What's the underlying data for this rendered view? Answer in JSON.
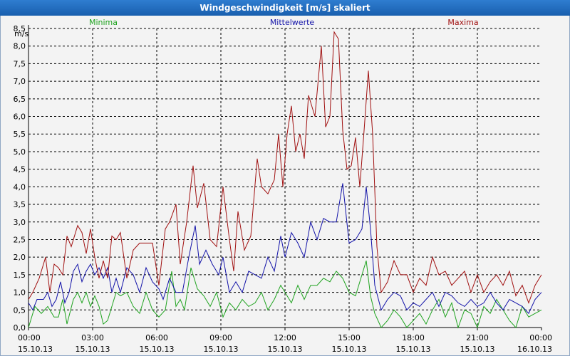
{
  "window": {
    "title": "Windgeschwindigkeit [m/s] skaliert"
  },
  "colors": {
    "minima": "#1fa31f",
    "mittel": "#1212a8",
    "maxima": "#a01010",
    "grid": "#000000"
  },
  "chart_data": {
    "type": "line",
    "title": "Windgeschwindigkeit [m/s] skaliert",
    "ylabel": "m/s",
    "ylim": [
      0,
      8.5
    ],
    "yticks": [
      "0,0",
      "0,5",
      "1,0",
      "1,5",
      "2,0",
      "2,5",
      "3,0",
      "3,5",
      "4,0",
      "4,5",
      "5,0",
      "5,5",
      "6,0",
      "6,5",
      "7,0",
      "7,5",
      "8,0",
      "8,5"
    ],
    "xlim": [
      0,
      24
    ],
    "xticks": [
      {
        "time": "00:00",
        "date": "15.10.13"
      },
      {
        "time": "03:00",
        "date": "15.10.13"
      },
      {
        "time": "06:00",
        "date": "15.10.13"
      },
      {
        "time": "09:00",
        "date": "15.10.13"
      },
      {
        "time": "12:00",
        "date": "15.10.13"
      },
      {
        "time": "15:00",
        "date": "15.10.13"
      },
      {
        "time": "18:00",
        "date": "15.10.13"
      },
      {
        "time": "21:00",
        "date": "15.10.13"
      },
      {
        "time": "00:00",
        "date": "16.10.13"
      }
    ],
    "grid": true,
    "legend_position": "top",
    "series": [
      {
        "name": "Minima",
        "color": "#1fa31f",
        "points": [
          [
            0,
            0.0
          ],
          [
            0.3,
            0.6
          ],
          [
            0.6,
            0.4
          ],
          [
            0.9,
            0.6
          ],
          [
            1.2,
            0.3
          ],
          [
            1.4,
            0.3
          ],
          [
            1.6,
            0.8
          ],
          [
            1.8,
            0.1
          ],
          [
            2.1,
            0.8
          ],
          [
            2.3,
            1.0
          ],
          [
            2.5,
            0.7
          ],
          [
            2.7,
            1.0
          ],
          [
            2.9,
            0.6
          ],
          [
            3.1,
            0.9
          ],
          [
            3.3,
            0.6
          ],
          [
            3.5,
            0.1
          ],
          [
            3.7,
            0.2
          ],
          [
            3.9,
            0.6
          ],
          [
            4.1,
            1.0
          ],
          [
            4.3,
            0.9
          ],
          [
            4.6,
            1.0
          ],
          [
            4.9,
            0.6
          ],
          [
            5.2,
            0.4
          ],
          [
            5.5,
            1.0
          ],
          [
            5.8,
            0.5
          ],
          [
            6.1,
            0.3
          ],
          [
            6.4,
            0.5
          ],
          [
            6.7,
            1.6
          ],
          [
            6.9,
            0.6
          ],
          [
            7.1,
            0.8
          ],
          [
            7.3,
            0.5
          ],
          [
            7.6,
            1.7
          ],
          [
            7.9,
            1.1
          ],
          [
            8.2,
            0.9
          ],
          [
            8.5,
            0.6
          ],
          [
            8.8,
            1.0
          ],
          [
            9.1,
            0.3
          ],
          [
            9.4,
            0.7
          ],
          [
            9.7,
            0.5
          ],
          [
            10.0,
            0.8
          ],
          [
            10.3,
            0.6
          ],
          [
            10.6,
            0.7
          ],
          [
            10.9,
            1.0
          ],
          [
            11.2,
            0.5
          ],
          [
            11.5,
            0.8
          ],
          [
            11.8,
            1.2
          ],
          [
            12.0,
            1.0
          ],
          [
            12.3,
            0.7
          ],
          [
            12.6,
            1.2
          ],
          [
            12.9,
            0.8
          ],
          [
            13.2,
            1.2
          ],
          [
            13.5,
            1.2
          ],
          [
            13.8,
            1.4
          ],
          [
            14.1,
            1.3
          ],
          [
            14.4,
            1.6
          ],
          [
            14.7,
            1.4
          ],
          [
            15.0,
            1.0
          ],
          [
            15.3,
            0.9
          ],
          [
            15.6,
            1.5
          ],
          [
            15.8,
            1.9
          ],
          [
            16.0,
            0.9
          ],
          [
            16.2,
            0.4
          ],
          [
            16.5,
            0.0
          ],
          [
            16.8,
            0.2
          ],
          [
            17.1,
            0.5
          ],
          [
            17.4,
            0.3
          ],
          [
            17.7,
            0.0
          ],
          [
            18.0,
            0.2
          ],
          [
            18.3,
            0.4
          ],
          [
            18.6,
            0.1
          ],
          [
            18.9,
            0.5
          ],
          [
            19.2,
            0.8
          ],
          [
            19.5,
            0.3
          ],
          [
            19.8,
            0.7
          ],
          [
            20.1,
            0.0
          ],
          [
            20.4,
            0.5
          ],
          [
            20.7,
            0.4
          ],
          [
            21.0,
            0.0
          ],
          [
            21.3,
            0.6
          ],
          [
            21.6,
            0.4
          ],
          [
            21.9,
            0.8
          ],
          [
            22.2,
            0.5
          ],
          [
            22.5,
            0.2
          ],
          [
            22.8,
            0.0
          ],
          [
            23.1,
            0.6
          ],
          [
            23.4,
            0.3
          ],
          [
            23.7,
            0.4
          ],
          [
            24.0,
            0.5
          ]
        ]
      },
      {
        "name": "Mittelwerte",
        "color": "#1212a8",
        "points": [
          [
            0,
            0.7
          ],
          [
            0.2,
            0.5
          ],
          [
            0.4,
            0.8
          ],
          [
            0.7,
            0.8
          ],
          [
            0.9,
            1.0
          ],
          [
            1.1,
            0.6
          ],
          [
            1.3,
            0.8
          ],
          [
            1.5,
            1.3
          ],
          [
            1.7,
            0.7
          ],
          [
            1.9,
            1.0
          ],
          [
            2.1,
            1.6
          ],
          [
            2.3,
            1.8
          ],
          [
            2.5,
            1.3
          ],
          [
            2.7,
            1.6
          ],
          [
            2.9,
            1.8
          ],
          [
            3.1,
            1.5
          ],
          [
            3.3,
            1.7
          ],
          [
            3.5,
            1.4
          ],
          [
            3.7,
            1.7
          ],
          [
            3.9,
            1.0
          ],
          [
            4.1,
            1.4
          ],
          [
            4.3,
            1.0
          ],
          [
            4.6,
            1.7
          ],
          [
            4.9,
            1.5
          ],
          [
            5.2,
            1.0
          ],
          [
            5.5,
            1.7
          ],
          [
            5.8,
            1.3
          ],
          [
            6.1,
            1.1
          ],
          [
            6.3,
            0.8
          ],
          [
            6.6,
            1.4
          ],
          [
            6.9,
            1.0
          ],
          [
            7.2,
            1.0
          ],
          [
            7.5,
            2.0
          ],
          [
            7.8,
            2.9
          ],
          [
            8.0,
            1.8
          ],
          [
            8.3,
            2.2
          ],
          [
            8.6,
            1.8
          ],
          [
            8.9,
            1.5
          ],
          [
            9.1,
            2.0
          ],
          [
            9.4,
            1.0
          ],
          [
            9.7,
            1.3
          ],
          [
            10.0,
            1.0
          ],
          [
            10.3,
            1.6
          ],
          [
            10.6,
            1.5
          ],
          [
            10.9,
            1.4
          ],
          [
            11.2,
            2.0
          ],
          [
            11.5,
            1.6
          ],
          [
            11.8,
            2.6
          ],
          [
            12.0,
            2.0
          ],
          [
            12.3,
            2.7
          ],
          [
            12.6,
            2.4
          ],
          [
            12.9,
            2.0
          ],
          [
            13.2,
            3.0
          ],
          [
            13.5,
            2.5
          ],
          [
            13.8,
            3.1
          ],
          [
            14.1,
            3.0
          ],
          [
            14.4,
            3.0
          ],
          [
            14.7,
            4.1
          ],
          [
            15.0,
            2.4
          ],
          [
            15.3,
            2.5
          ],
          [
            15.6,
            2.8
          ],
          [
            15.8,
            4.0
          ],
          [
            16.0,
            2.8
          ],
          [
            16.2,
            1.2
          ],
          [
            16.5,
            0.5
          ],
          [
            16.8,
            0.8
          ],
          [
            17.1,
            1.0
          ],
          [
            17.4,
            0.9
          ],
          [
            17.7,
            0.5
          ],
          [
            18.0,
            0.7
          ],
          [
            18.3,
            0.6
          ],
          [
            18.6,
            0.8
          ],
          [
            18.9,
            1.0
          ],
          [
            19.2,
            0.6
          ],
          [
            19.5,
            1.0
          ],
          [
            19.8,
            0.9
          ],
          [
            20.1,
            0.7
          ],
          [
            20.4,
            0.6
          ],
          [
            20.7,
            0.8
          ],
          [
            21.0,
            0.6
          ],
          [
            21.3,
            0.7
          ],
          [
            21.6,
            1.0
          ],
          [
            21.9,
            0.7
          ],
          [
            22.2,
            0.5
          ],
          [
            22.5,
            0.8
          ],
          [
            22.8,
            0.7
          ],
          [
            23.1,
            0.6
          ],
          [
            23.4,
            0.4
          ],
          [
            23.7,
            0.8
          ],
          [
            24.0,
            1.0
          ]
        ]
      },
      {
        "name": "Maxima",
        "color": "#a01010",
        "points": [
          [
            0,
            0.8
          ],
          [
            0.2,
            1.0
          ],
          [
            0.5,
            1.4
          ],
          [
            0.8,
            2.0
          ],
          [
            1.0,
            1.0
          ],
          [
            1.2,
            1.8
          ],
          [
            1.4,
            1.7
          ],
          [
            1.6,
            1.5
          ],
          [
            1.8,
            2.6
          ],
          [
            2.0,
            2.3
          ],
          [
            2.3,
            2.9
          ],
          [
            2.5,
            2.7
          ],
          [
            2.7,
            2.1
          ],
          [
            2.9,
            2.8
          ],
          [
            3.1,
            2.0
          ],
          [
            3.3,
            1.4
          ],
          [
            3.5,
            1.9
          ],
          [
            3.7,
            1.4
          ],
          [
            3.9,
            2.6
          ],
          [
            4.1,
            2.5
          ],
          [
            4.3,
            2.7
          ],
          [
            4.6,
            1.4
          ],
          [
            4.9,
            2.2
          ],
          [
            5.2,
            2.4
          ],
          [
            5.5,
            2.4
          ],
          [
            5.8,
            2.4
          ],
          [
            6.1,
            1.2
          ],
          [
            6.4,
            2.8
          ],
          [
            6.6,
            3.0
          ],
          [
            6.9,
            3.5
          ],
          [
            7.1,
            1.8
          ],
          [
            7.4,
            3.0
          ],
          [
            7.7,
            4.6
          ],
          [
            7.9,
            3.4
          ],
          [
            8.2,
            4.1
          ],
          [
            8.5,
            2.5
          ],
          [
            8.8,
            2.3
          ],
          [
            9.1,
            4.0
          ],
          [
            9.4,
            2.5
          ],
          [
            9.6,
            1.6
          ],
          [
            9.8,
            3.3
          ],
          [
            10.1,
            2.2
          ],
          [
            10.4,
            2.6
          ],
          [
            10.7,
            4.8
          ],
          [
            10.9,
            4.0
          ],
          [
            11.2,
            3.8
          ],
          [
            11.5,
            4.2
          ],
          [
            11.7,
            5.5
          ],
          [
            11.9,
            4.0
          ],
          [
            12.1,
            5.5
          ],
          [
            12.3,
            6.3
          ],
          [
            12.5,
            5.0
          ],
          [
            12.7,
            5.5
          ],
          [
            12.9,
            4.8
          ],
          [
            13.1,
            6.6
          ],
          [
            13.4,
            6.0
          ],
          [
            13.7,
            8.0
          ],
          [
            13.9,
            5.7
          ],
          [
            14.1,
            6.0
          ],
          [
            14.3,
            8.4
          ],
          [
            14.5,
            8.2
          ],
          [
            14.7,
            5.6
          ],
          [
            14.9,
            4.5
          ],
          [
            15.1,
            4.6
          ],
          [
            15.3,
            5.4
          ],
          [
            15.5,
            4.0
          ],
          [
            15.7,
            5.6
          ],
          [
            15.9,
            7.3
          ],
          [
            16.1,
            5.5
          ],
          [
            16.3,
            2.3
          ],
          [
            16.5,
            1.0
          ],
          [
            16.8,
            1.3
          ],
          [
            17.1,
            1.9
          ],
          [
            17.4,
            1.5
          ],
          [
            17.7,
            1.5
          ],
          [
            18.0,
            1.0
          ],
          [
            18.3,
            1.4
          ],
          [
            18.6,
            1.2
          ],
          [
            18.9,
            2.0
          ],
          [
            19.2,
            1.5
          ],
          [
            19.5,
            1.6
          ],
          [
            19.8,
            1.2
          ],
          [
            20.1,
            1.4
          ],
          [
            20.4,
            1.6
          ],
          [
            20.7,
            1.0
          ],
          [
            21.0,
            1.5
          ],
          [
            21.3,
            1.0
          ],
          [
            21.6,
            1.3
          ],
          [
            21.9,
            1.5
          ],
          [
            22.2,
            1.2
          ],
          [
            22.5,
            1.6
          ],
          [
            22.8,
            0.9
          ],
          [
            23.1,
            1.2
          ],
          [
            23.4,
            0.7
          ],
          [
            23.7,
            1.2
          ],
          [
            24.0,
            1.5
          ]
        ]
      }
    ]
  }
}
